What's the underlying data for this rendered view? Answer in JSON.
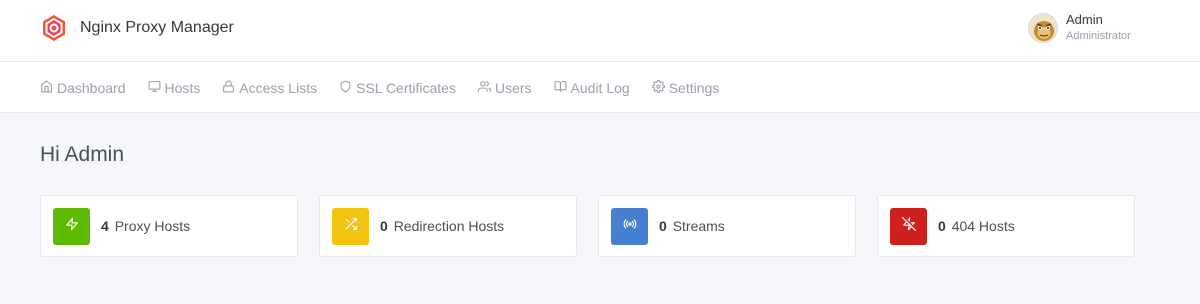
{
  "app": {
    "brand_name": "Nginx Proxy Manager",
    "logo_icon": "nginx-proxy-manager-logo"
  },
  "user": {
    "name": "Admin",
    "role": "Administrator",
    "avatar_icon": "user-avatar"
  },
  "nav": {
    "items": [
      {
        "label": "Dashboard",
        "icon": "home-icon"
      },
      {
        "label": "Hosts",
        "icon": "monitor-icon"
      },
      {
        "label": "Access Lists",
        "icon": "lock-icon"
      },
      {
        "label": "SSL Certificates",
        "icon": "shield-icon"
      },
      {
        "label": "Users",
        "icon": "users-icon"
      },
      {
        "label": "Audit Log",
        "icon": "book-open-icon"
      },
      {
        "label": "Settings",
        "icon": "gear-icon"
      }
    ]
  },
  "main": {
    "greeting": "Hi Admin",
    "cards": [
      {
        "count": "4",
        "label": "Proxy Hosts",
        "icon": "zap-icon",
        "color": "#5eba00"
      },
      {
        "count": "0",
        "label": "Redirection Hosts",
        "icon": "shuffle-icon",
        "color": "#f1c40f"
      },
      {
        "count": "0",
        "label": "Streams",
        "icon": "radio-icon",
        "color": "#467fcf"
      },
      {
        "count": "0",
        "label": "404 Hosts",
        "icon": "zap-off-icon",
        "color": "#cd201f"
      }
    ]
  }
}
